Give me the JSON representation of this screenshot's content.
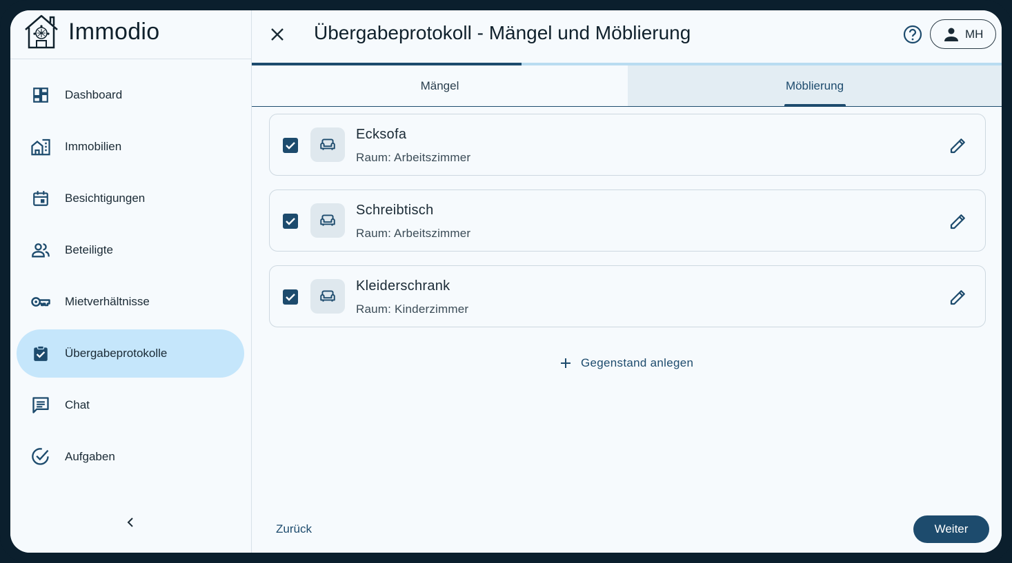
{
  "app": {
    "name": "Immodio",
    "logo_icon": "house-circuit-logo"
  },
  "sidebar": {
    "items": [
      {
        "label": "Dashboard",
        "icon": "dashboard-icon"
      },
      {
        "label": "Immobilien",
        "icon": "buildings-icon"
      },
      {
        "label": "Besichtigungen",
        "icon": "calendar-icon"
      },
      {
        "label": "Beteiligte",
        "icon": "people-icon"
      },
      {
        "label": "Mietverhältnisse",
        "icon": "key-icon"
      },
      {
        "label": "Übergabeprotokolle",
        "icon": "clipboard-check-icon",
        "active": true
      },
      {
        "label": "Chat",
        "icon": "chat-icon"
      },
      {
        "label": "Aufgaben",
        "icon": "task-check-icon"
      }
    ],
    "collapse_icon": "chevron-left-icon"
  },
  "header": {
    "title": "Übergabeprotokoll - Mängel und Möblierung",
    "user_initials": "MH"
  },
  "progress": {
    "fraction": 0.36
  },
  "tabs": [
    {
      "label": "Mängel"
    },
    {
      "label": "Möblierung",
      "active": true
    }
  ],
  "items": [
    {
      "title": "Ecksofa",
      "room": "Raum: Arbeitszimmer",
      "checked": true
    },
    {
      "title": "Schreibtisch",
      "room": "Raum: Arbeitszimmer",
      "checked": true
    },
    {
      "title": "Kleiderschrank",
      "room": "Raum: Kinderzimmer",
      "checked": true
    }
  ],
  "actions": {
    "add_label": "Gegenstand anlegen",
    "back_label": "Zurück",
    "next_label": "Weiter"
  },
  "colors": {
    "primary": "#1d4b6d",
    "active_nav": "#c5e6fb",
    "progress_track": "#b9dcf1",
    "background": "#f6fafd"
  }
}
